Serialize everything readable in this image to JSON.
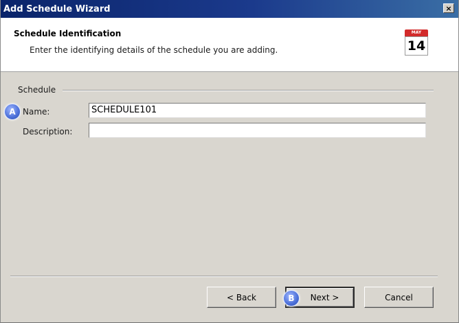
{
  "window": {
    "title": "Add Schedule Wizard",
    "close_glyph": "×"
  },
  "header": {
    "title": "Schedule Identification",
    "subtitle": "Enter the identifying details of the schedule you are adding.",
    "calendar_icon": {
      "name": "calendar-icon",
      "month": "MAY",
      "day": "14",
      "color": "#d22b2b"
    }
  },
  "form": {
    "group_label": "Schedule",
    "name_label": "Name:",
    "name_value": "SCHEDULE101",
    "description_label": "Description:",
    "description_value": ""
  },
  "callouts": {
    "a": "A",
    "b": "B",
    "color": "#4b6fd8"
  },
  "buttons": {
    "back": "< Back",
    "next": "Next >",
    "cancel": "Cancel"
  }
}
